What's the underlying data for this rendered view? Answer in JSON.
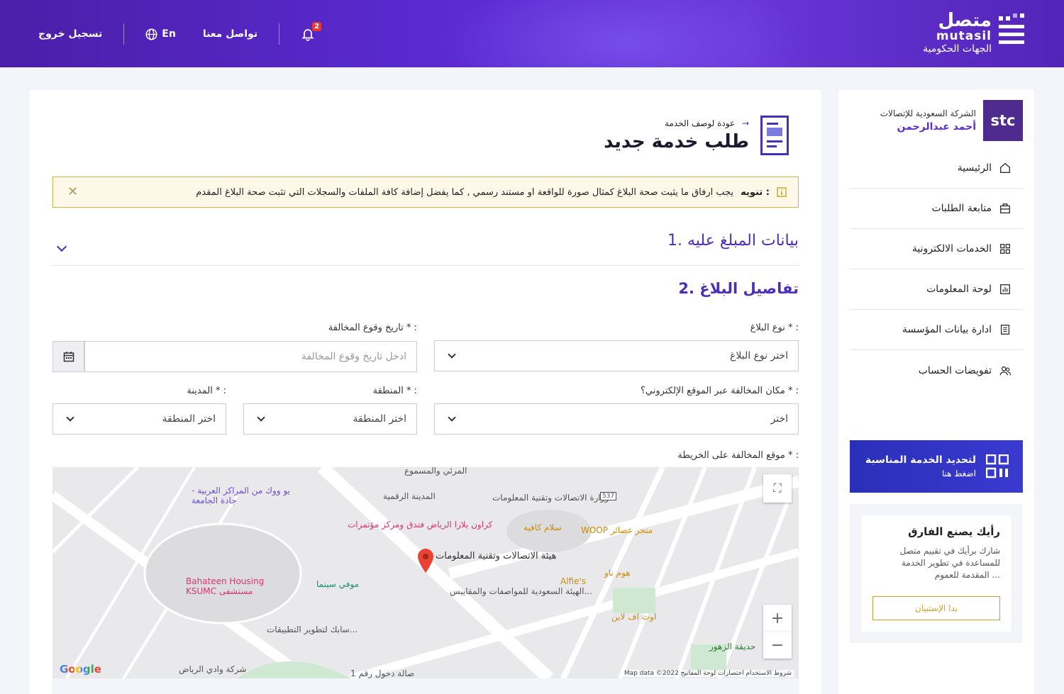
{
  "header": {
    "logo_ar": "متصل",
    "logo_en": "mutasil",
    "logo_sub": "الجهات الحكومية",
    "notifications_count": "2",
    "contact": "تواصل معنا",
    "language": "En",
    "logout": "تسجيل خروج"
  },
  "sidebar": {
    "company": "الشركة السعودية للإتصالات",
    "user": "أحمد عبدالرحمن",
    "logo_text": "stc",
    "items": [
      {
        "label": "الرئيسية",
        "icon": "home-icon"
      },
      {
        "label": "متابعة الطلبات",
        "icon": "briefcase-icon"
      },
      {
        "label": "الخدمات الالكترونية",
        "icon": "grid-icon"
      },
      {
        "label": "لوحة المعلومات",
        "icon": "chart-icon"
      },
      {
        "label": "ادارة بيانات المؤسسة",
        "icon": "building-icon"
      },
      {
        "label": "تفويضات الحساب",
        "icon": "users-icon"
      }
    ],
    "promo": {
      "title": "لتحديد الخدمة المناسبة",
      "sub": "اضغط هنا"
    },
    "feedback": {
      "title": "رأيك يصنع الفارق",
      "text": "شارك برأيك في تقييم متصل للمساعدة في تطوير الخدمة المقدمة للعموم ...",
      "button": "بدا الإستبيان"
    }
  },
  "main": {
    "back_link": "عودة لوصف الخدمة",
    "title": "طلب خدمة جديد",
    "alert_label": "تنويه :",
    "alert_text": "يجب ارفاق ما يثبت صحة البلاغ كمثال صورة للواقعة او مستند رسمي , كما يفضل إضافة كافة الملفات والسجلات التي تثبت صحة البلاغ المقدم",
    "section1": "1. بيانات المبلغ عليه",
    "section2": "2. تفاصيل البلاغ",
    "fields": {
      "report_type_label": "نوع البلاغ * :",
      "report_type_value": "اختر نوع البلاغ",
      "date_label": "تاريخ وقوع المخالفة * :",
      "date_placeholder": "ادخل تاريخ وقوع المخالفة",
      "online_label": "مكان المخالفة عبر الموقع الإلكتروني؟ * :",
      "online_value": "اختر",
      "region_label": "المنطقة * :",
      "region_value": "اختر المنطقة",
      "city_label": "المدينة * :",
      "city_value": "اختر المنطقة",
      "map_label": "موقع المخالفة على الخريطة * :"
    },
    "map": {
      "labels": {
        "stc_hq": "هيئة الاتصالات وتقنية المعلومات",
        "mcit": "وزارة الاتصالات وتقنية المعلومات",
        "digital_city": "المدينة الرقمية",
        "crown": "كراون بلازا الرياض فندق ومركز مؤتمرات",
        "saso": "الهيئة السعودية للمواصفات والمقاييس...",
        "salam": "سلام كافيه",
        "woop": "WOOP متجر عصائر",
        "alfies": "Alfie's",
        "homenow": "هوم ناو",
        "outoflane": "اوت اف لاين",
        "zuhur": "حديقة الزهور",
        "bahateen": "Bahateen Housing KSUMC مستشفى",
        "movie": "موفي سينما",
        "wework": "يو ووك من المراكز العربية - جادة الجامعة",
        "tuwaiq": "سابك لتطوير التطبيقات...",
        "wadi": "شركة وادي الرياض",
        "hall": "صالة دخول رقم 1",
        "audio": "المرئي والمسموع",
        "road537": "537"
      },
      "google": "Google",
      "attribution": "Map data ©2022  شروط الاستخدام  اختصارات لوحة المفاتيح"
    }
  }
}
